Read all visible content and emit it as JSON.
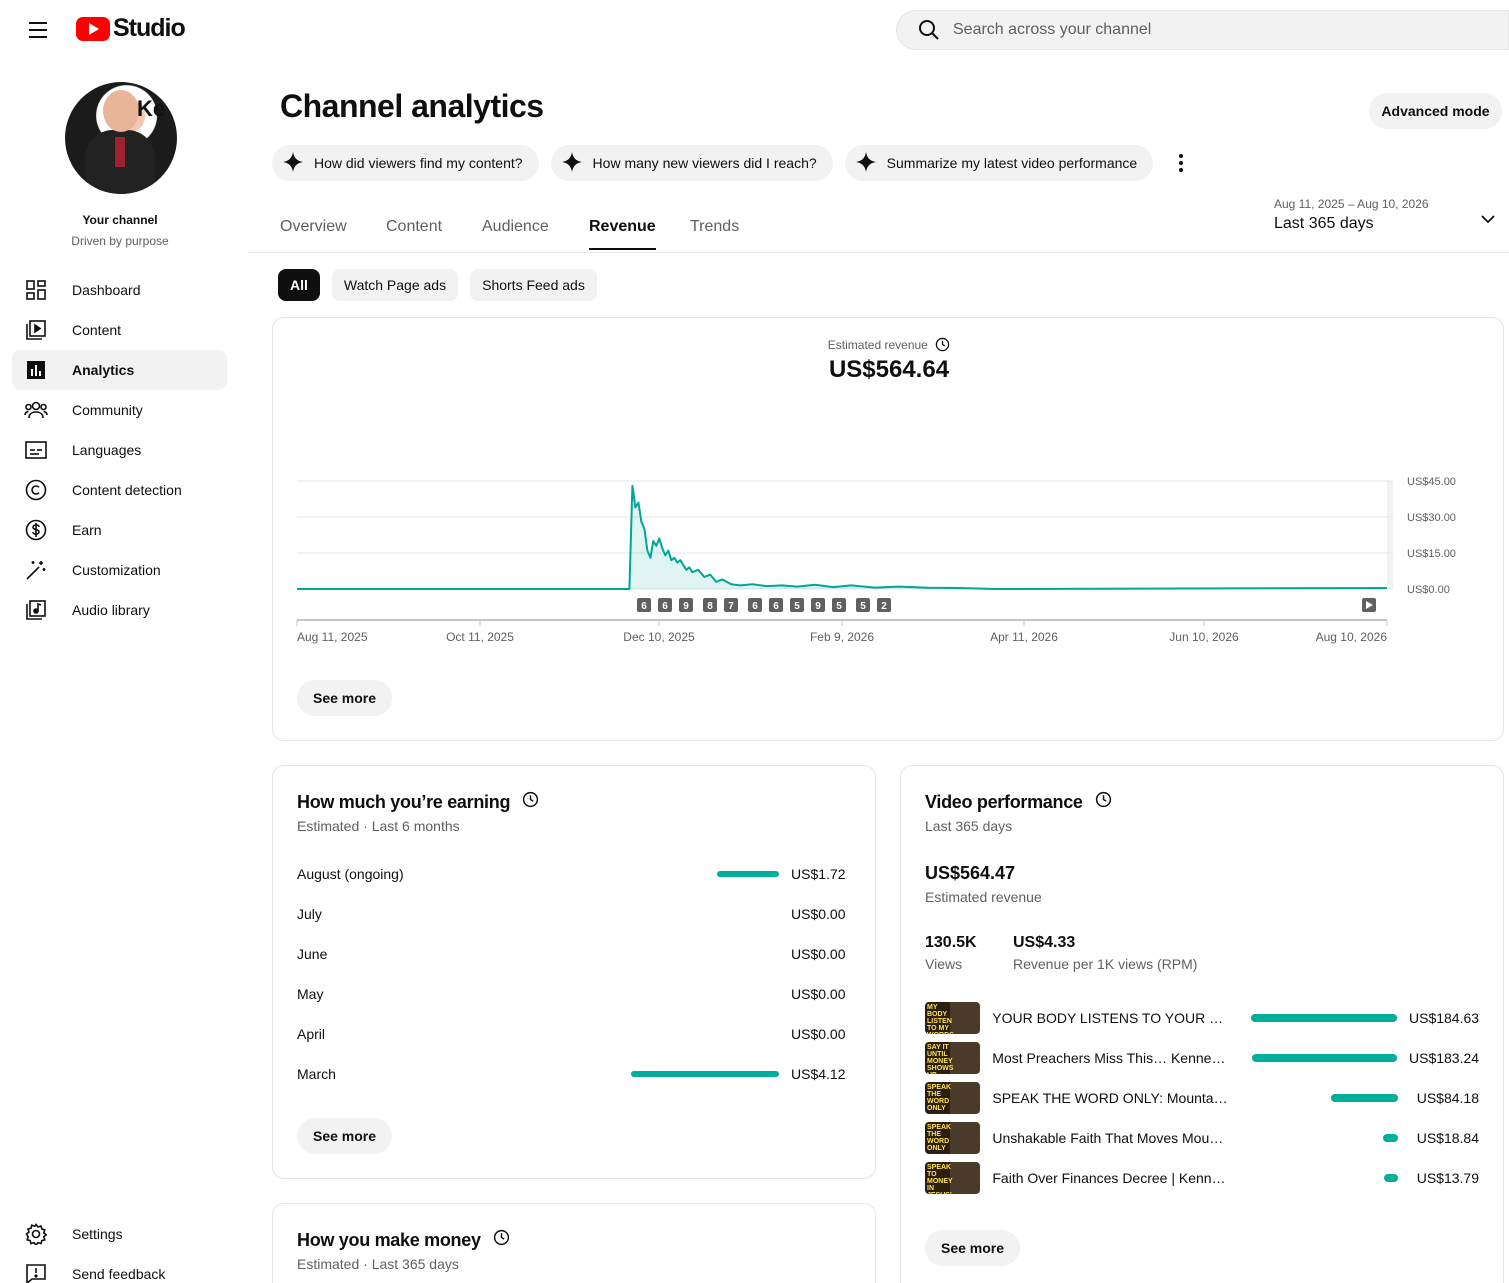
{
  "header": {
    "logo_text": "Studio",
    "search_placeholder": "Search across your channel"
  },
  "sidebar": {
    "channel_name": "Your channel",
    "channel_tagline": "Driven by purpose",
    "avatar_overlay_text": "Ke",
    "items": [
      {
        "label": "Dashboard",
        "icon": "dashboard-icon",
        "active": false
      },
      {
        "label": "Content",
        "icon": "content-icon",
        "active": false
      },
      {
        "label": "Analytics",
        "icon": "analytics-icon",
        "active": true
      },
      {
        "label": "Community",
        "icon": "community-icon",
        "active": false
      },
      {
        "label": "Languages",
        "icon": "subtitles-icon",
        "active": false
      },
      {
        "label": "Content detection",
        "icon": "copyright-icon",
        "active": false
      },
      {
        "label": "Earn",
        "icon": "dollar-icon",
        "active": false
      },
      {
        "label": "Customization",
        "icon": "magic-wand-icon",
        "active": false
      },
      {
        "label": "Audio library",
        "icon": "audio-library-icon",
        "active": false
      }
    ],
    "bottom_items": [
      {
        "label": "Settings",
        "icon": "gear-icon"
      },
      {
        "label": "Send feedback",
        "icon": "feedback-icon"
      }
    ]
  },
  "page": {
    "title": "Channel analytics",
    "advanced_mode_label": "Advanced mode",
    "ai_prompts": [
      "How did viewers find my content?",
      "How many new viewers did I reach?",
      "Summarize my latest video performance"
    ],
    "tabs": [
      "Overview",
      "Content",
      "Audience",
      "Revenue",
      "Trends"
    ],
    "active_tab": "Revenue",
    "date_range": {
      "dates": "Aug 11, 2025 – Aug 10, 2026",
      "label": "Last 365 days"
    },
    "filters": [
      "All",
      "Watch Page ads",
      "Shorts Feed ads"
    ],
    "active_filter": "All"
  },
  "revenue_chart": {
    "metric_label": "Estimated revenue",
    "metric_value": "US$564.64",
    "see_more_label": "See more",
    "video_markers": [
      "6",
      "6",
      "9",
      "8",
      "7",
      "6",
      "6",
      "5",
      "9",
      "5",
      "5",
      "2"
    ],
    "y_tick_labels": [
      "US$45.00",
      "US$30.00",
      "US$15.00",
      "US$0.00"
    ],
    "x_tick_labels": [
      "Aug 11, 2025",
      "Oct 11, 2025",
      "Dec 10, 2025",
      "Feb 9, 2026",
      "Apr 11, 2026",
      "Jun 10, 2026",
      "Aug 10, 2026"
    ],
    "accent_color": "#00a69a"
  },
  "chart_data": {
    "type": "area",
    "title": "Estimated revenue",
    "xlabel": "",
    "ylabel": "",
    "ylim": [
      0,
      45
    ],
    "grid": true,
    "x_range": [
      "2025-08-11",
      "2026-08-10"
    ],
    "series": [
      {
        "x": [
          "2025-08-11",
          "2025-11-30",
          "2025-12-01",
          "2025-12-02",
          "2025-12-03",
          "2025-12-04",
          "2025-12-05",
          "2025-12-06",
          "2025-12-07",
          "2025-12-08",
          "2025-12-09",
          "2025-12-10",
          "2025-12-11",
          "2025-12-12",
          "2025-12-13",
          "2025-12-14",
          "2025-12-15",
          "2025-12-16",
          "2025-12-17",
          "2025-12-18",
          "2025-12-19",
          "2025-12-20",
          "2025-12-21",
          "2025-12-23",
          "2025-12-25",
          "2025-12-27",
          "2025-12-29",
          "2025-12-31",
          "2026-01-03",
          "2026-01-06",
          "2026-01-10",
          "2026-01-15",
          "2026-01-20",
          "2026-01-25",
          "2026-01-31",
          "2026-02-06",
          "2026-02-12",
          "2026-02-20",
          "2026-02-28",
          "2026-03-10",
          "2026-03-20",
          "2026-04-01",
          "2026-08-10"
        ],
        "values": [
          0,
          0,
          43,
          34,
          36,
          28,
          25,
          16,
          13,
          20,
          18,
          21,
          17,
          14,
          16,
          12,
          13,
          11,
          12,
          10,
          8,
          9,
          7,
          8,
          5,
          6,
          3,
          4,
          2,
          1.5,
          2,
          1.2,
          1.5,
          1,
          1.8,
          0.8,
          1.5,
          0.6,
          1,
          0.5,
          0.4,
          0,
          0.4
        ]
      }
    ]
  },
  "earnings": {
    "title": "How much you’re earning",
    "subtitle": "Estimated · Last 6 months",
    "rows": [
      {
        "month": "August (ongoing)",
        "value": "US$1.72",
        "amount": 1.72
      },
      {
        "month": "July",
        "value": "US$0.00",
        "amount": 0
      },
      {
        "month": "June",
        "value": "US$0.00",
        "amount": 0
      },
      {
        "month": "May",
        "value": "US$0.00",
        "amount": 0
      },
      {
        "month": "April",
        "value": "US$0.00",
        "amount": 0
      },
      {
        "month": "March",
        "value": "US$4.12",
        "amount": 4.12
      }
    ],
    "see_more_label": "See more"
  },
  "video_performance": {
    "title": "Video performance",
    "subtitle": "Last 365 days",
    "total": "US$564.47",
    "total_label": "Estimated revenue",
    "views": "130.5K",
    "views_label": "Views",
    "rpm": "US$4.33",
    "rpm_label": "Revenue per 1K views (RPM)",
    "videos": [
      {
        "title": "YOUR BODY LISTENS TO YOUR WO…",
        "value": "US$184.63",
        "amount": 184.63,
        "thumb_text": "MY BODY LISTEN TO MY WORDS"
      },
      {
        "title": "Most Preachers Miss This… Kennet…",
        "value": "US$183.24",
        "amount": 183.24,
        "thumb_text": "SAY IT UNTIL MONEY SHOWS UP"
      },
      {
        "title": "SPEAK THE WORD ONLY: Mountai…",
        "value": "US$84.18",
        "amount": 84.18,
        "thumb_text": "SPEAK THE WORD ONLY"
      },
      {
        "title": "Unshakable Faith That Moves Mou…",
        "value": "US$18.84",
        "amount": 18.84,
        "thumb_text": "SPEAK THE WORD ONLY"
      },
      {
        "title": "Faith Over Finances Decree | Kenne…",
        "value": "US$13.79",
        "amount": 13.79,
        "thumb_text": "SPEAK TO MONEY IN JESUS' NAME"
      }
    ],
    "see_more_label": "See more"
  },
  "make_money": {
    "title": "How you make money",
    "subtitle": "Estimated · Last 365 days"
  }
}
